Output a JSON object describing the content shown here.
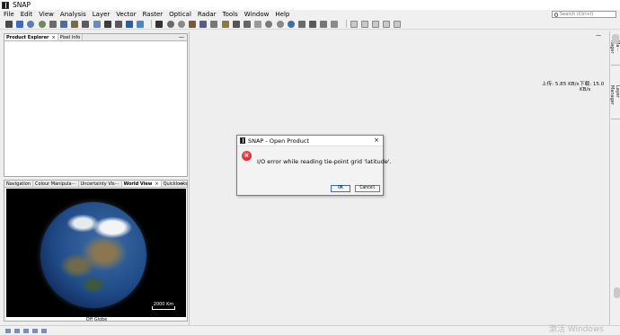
{
  "window": {
    "title": "SNAP"
  },
  "menu": {
    "items": [
      "File",
      "Edit",
      "View",
      "Analysis",
      "Layer",
      "Vector",
      "Raster",
      "Optical",
      "Radar",
      "Tools",
      "Window",
      "Help"
    ]
  },
  "search": {
    "placeholder": "Search (Ctrl+I)"
  },
  "toolbar": {
    "icons": [
      "open-product-icon",
      "save-icon",
      "refresh-icon",
      "product-library-icon",
      "graph-builder-icon",
      "batch-icon",
      "subset-icon",
      "band-maths-icon",
      "dem-icon",
      "histogram-icon",
      "statistics-icon",
      "layer-icon",
      "roi-icon",
      "select-tool-icon",
      "pan-tool-icon",
      "zoom-tool-icon",
      "pin-tool-icon",
      "gcp-tool-icon",
      "range-finder-icon",
      "magic-wand-icon",
      "draw-line-icon",
      "draw-polyline-icon",
      "draw-rectangle-icon",
      "draw-polygon-icon",
      "draw-ellipse-icon",
      "world-map-icon",
      "time-series-icon",
      "spectrum-icon",
      "profile-icon",
      "scatter-plot-icon",
      "tile-horizontal-icon",
      "tile-vertical-icon",
      "tile-evenly-icon",
      "cascade-icon",
      "close-all-icon"
    ]
  },
  "left_top_panel": {
    "tabs": [
      {
        "label": "Product Explorer",
        "close": "×"
      },
      {
        "label": "Pixel Info"
      }
    ],
    "minimize": "—"
  },
  "left_bottom_panel": {
    "tabs": [
      {
        "label": "Navigation"
      },
      {
        "label": "Colour Manipula⋯"
      },
      {
        "label": "Uncertainty Vis⋯"
      },
      {
        "label": "World View",
        "close": "×"
      },
      {
        "label": "Quicklooks"
      }
    ],
    "minimize": "—",
    "scale_label": "2000 Km",
    "footer_label": "Off Globe"
  },
  "main": {
    "minimize": "—",
    "upload": "上传: 5.85 KB/s",
    "download": "下载: 15.0 KB/s"
  },
  "right_strip": {
    "tabs": [
      "Ma⋯nager",
      "Layer Manager"
    ]
  },
  "dialog": {
    "title": "SNAP - Open Product",
    "close": "×",
    "error_glyph": "×",
    "message": "I/O error while reading tie-point grid 'latitude'.",
    "ok_label": "OK",
    "cancel_label": "Cancel"
  },
  "watermark": "激活 Windows",
  "colors": {
    "error_red": "#c01818",
    "globe_ocean": "#1f4a86",
    "accent_blue": "#3b6cc4"
  }
}
